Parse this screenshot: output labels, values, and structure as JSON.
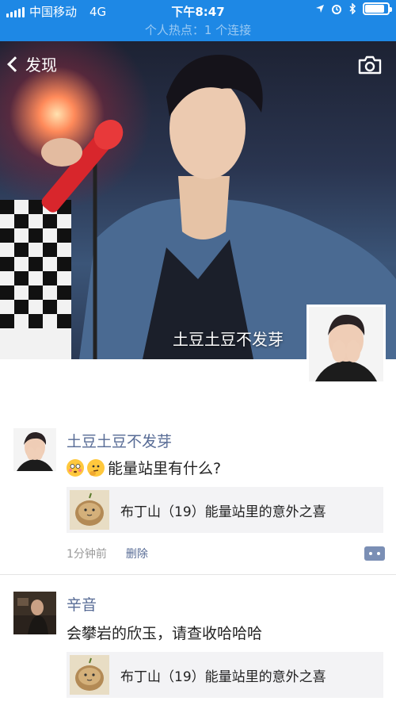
{
  "status_bar": {
    "carrier": "中国移动",
    "network": "4G",
    "time": "下午8:47",
    "battery_level": 0.85,
    "icons": [
      "signal-icon",
      "location-icon",
      "alarm-icon",
      "bluetooth-icon",
      "battery-icon"
    ]
  },
  "hotspot_bar": {
    "text": "个人热点：1 个连接"
  },
  "header": {
    "back_label": "发现",
    "camera_icon": "camera-icon"
  },
  "cover": {
    "username": "土豆土豆不发芽"
  },
  "posts": [
    {
      "name": "土豆土豆不发芽",
      "text": "能量站里有什么?",
      "emojis": [
        "flushed-face-emoji",
        "thinking-face-emoji"
      ],
      "link_title": "布丁山（19）能量站里的意外之喜",
      "time": "1分钟前",
      "delete_label": "删除"
    },
    {
      "name": "辛音",
      "text": "会攀岩的欣玉，请查收哈哈哈",
      "link_title": "布丁山（19）能量站里的意外之喜"
    }
  ],
  "colors": {
    "accent": "#1e88e5",
    "link_name": "#576b95",
    "card_bg": "#f3f3f5"
  }
}
